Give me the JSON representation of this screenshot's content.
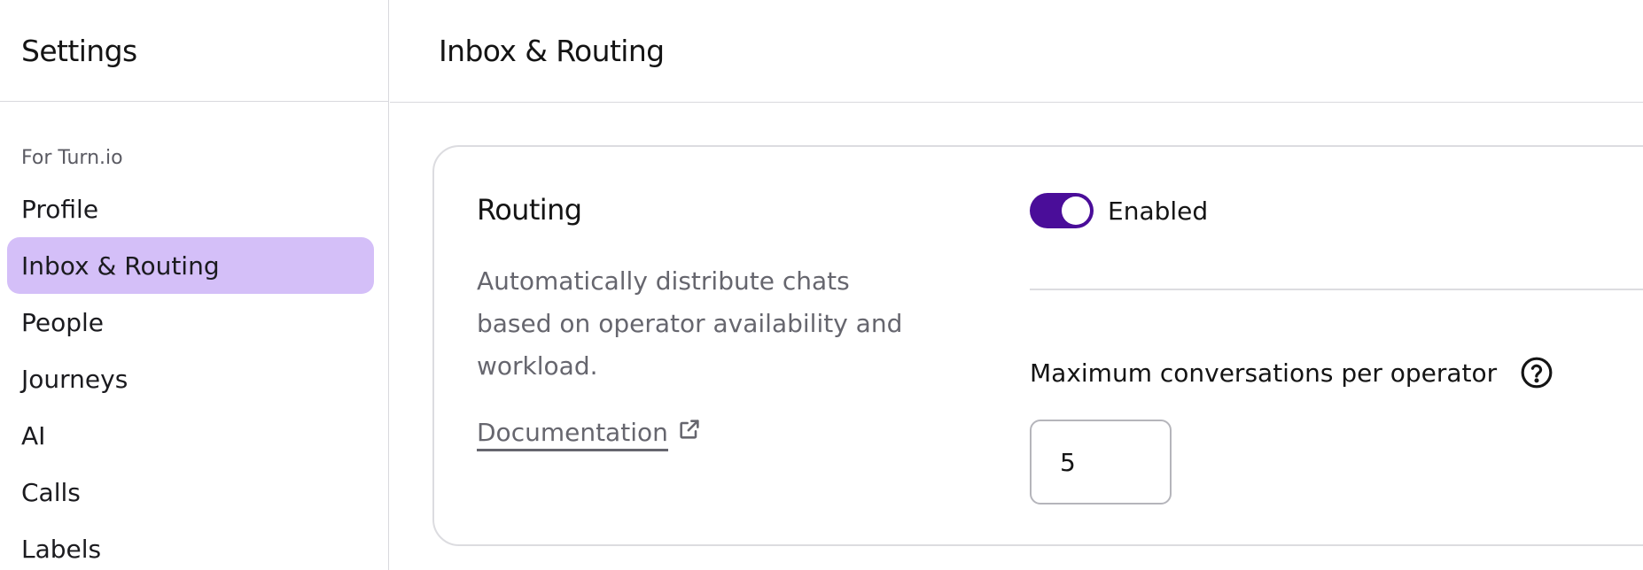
{
  "sidebar": {
    "title": "Settings",
    "section_label": "For Turn.io",
    "items": [
      {
        "label": "Profile"
      },
      {
        "label": "Inbox & Routing"
      },
      {
        "label": "People"
      },
      {
        "label": "Journeys"
      },
      {
        "label": "AI"
      },
      {
        "label": "Calls"
      },
      {
        "label": "Labels"
      }
    ],
    "active_item": "Inbox & Routing"
  },
  "header": {
    "title": "Inbox & Routing"
  },
  "routing_card": {
    "title": "Routing",
    "description": "Automatically distribute chats based on operator availability and workload.",
    "doc_link_label": "Documentation",
    "doc_link_icon": "external-link-icon",
    "toggle": {
      "enabled": true,
      "label": "Enabled"
    },
    "max_conversations": {
      "label": "Maximum conversations per operator",
      "help_icon": "question-circle-icon",
      "value": "5"
    }
  },
  "colors": {
    "accent": "#4a0d99",
    "active_nav_bg": "#d4bff8",
    "border": "#d9d9de",
    "muted_text": "#66666e"
  }
}
